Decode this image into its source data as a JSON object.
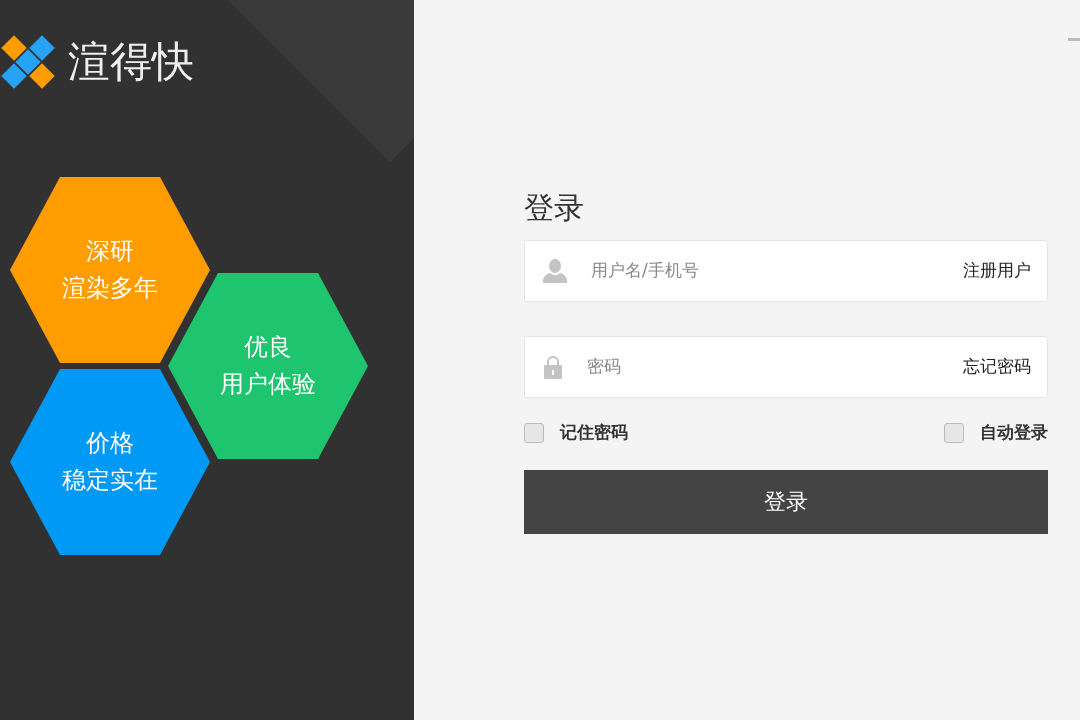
{
  "brand": {
    "name": "渲得快"
  },
  "features": [
    {
      "lines": [
        "深研",
        "渲染多年"
      ],
      "color": "#ff9c00"
    },
    {
      "lines": [
        "优良",
        "用户体验"
      ],
      "color": "#1ec46e"
    },
    {
      "lines": [
        "价格",
        "稳定实在"
      ],
      "color": "#0099f5"
    }
  ],
  "login": {
    "title": "登录",
    "fields": [
      {
        "kind": "user",
        "placeholder": "用户名/手机号",
        "link": "注册用户"
      },
      {
        "kind": "password",
        "placeholder": "密码",
        "link": "忘记密码"
      }
    ],
    "options": [
      {
        "label": "记住密码",
        "checked": false
      },
      {
        "label": "自动登录",
        "checked": false
      }
    ],
    "submit": "登录"
  }
}
